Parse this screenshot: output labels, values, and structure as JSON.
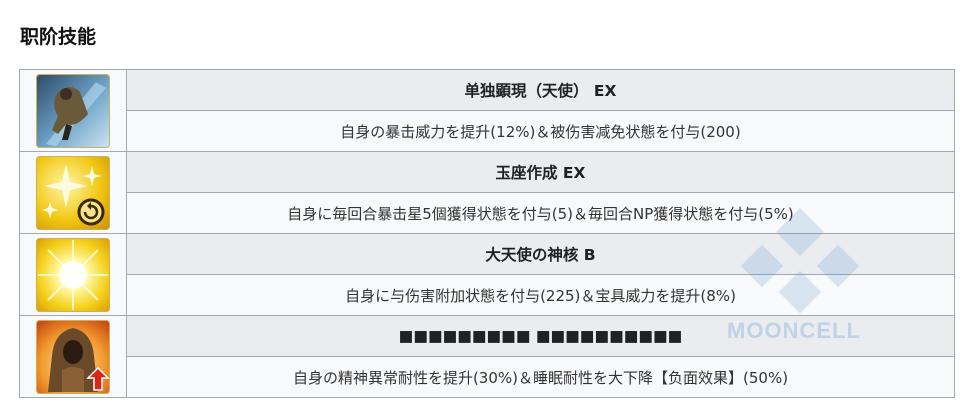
{
  "section": {
    "title": "职阶技能"
  },
  "skills": [
    {
      "name": "单独顕現（天使） EX",
      "description": "自身の暴击威力を提升(12%)＆被伤害减免状態を付与(200)",
      "icon": "cloaked-figure-icon"
    },
    {
      "name": "玉座作成 EX",
      "description": "自身に毎回合暴击星5個獲得状態を付与(5)＆毎回合NP獲得状態を付与(5%)",
      "icon": "star-regen-icon"
    },
    {
      "name": "大天使の神核 B",
      "description": "自身に与伤害附加状態を付与(225)＆宝具威力を提升(8%)",
      "icon": "divine-core-icon"
    },
    {
      "name": "■■■■■■■■■ ■■■■■■■■■■",
      "description": "自身の精神異常耐性を提升(30%)＆睡眠耐性を大下降【负面效果】(50%)",
      "icon": "hooded-figure-icon"
    }
  ],
  "watermark": {
    "text": "MOONCELL"
  }
}
